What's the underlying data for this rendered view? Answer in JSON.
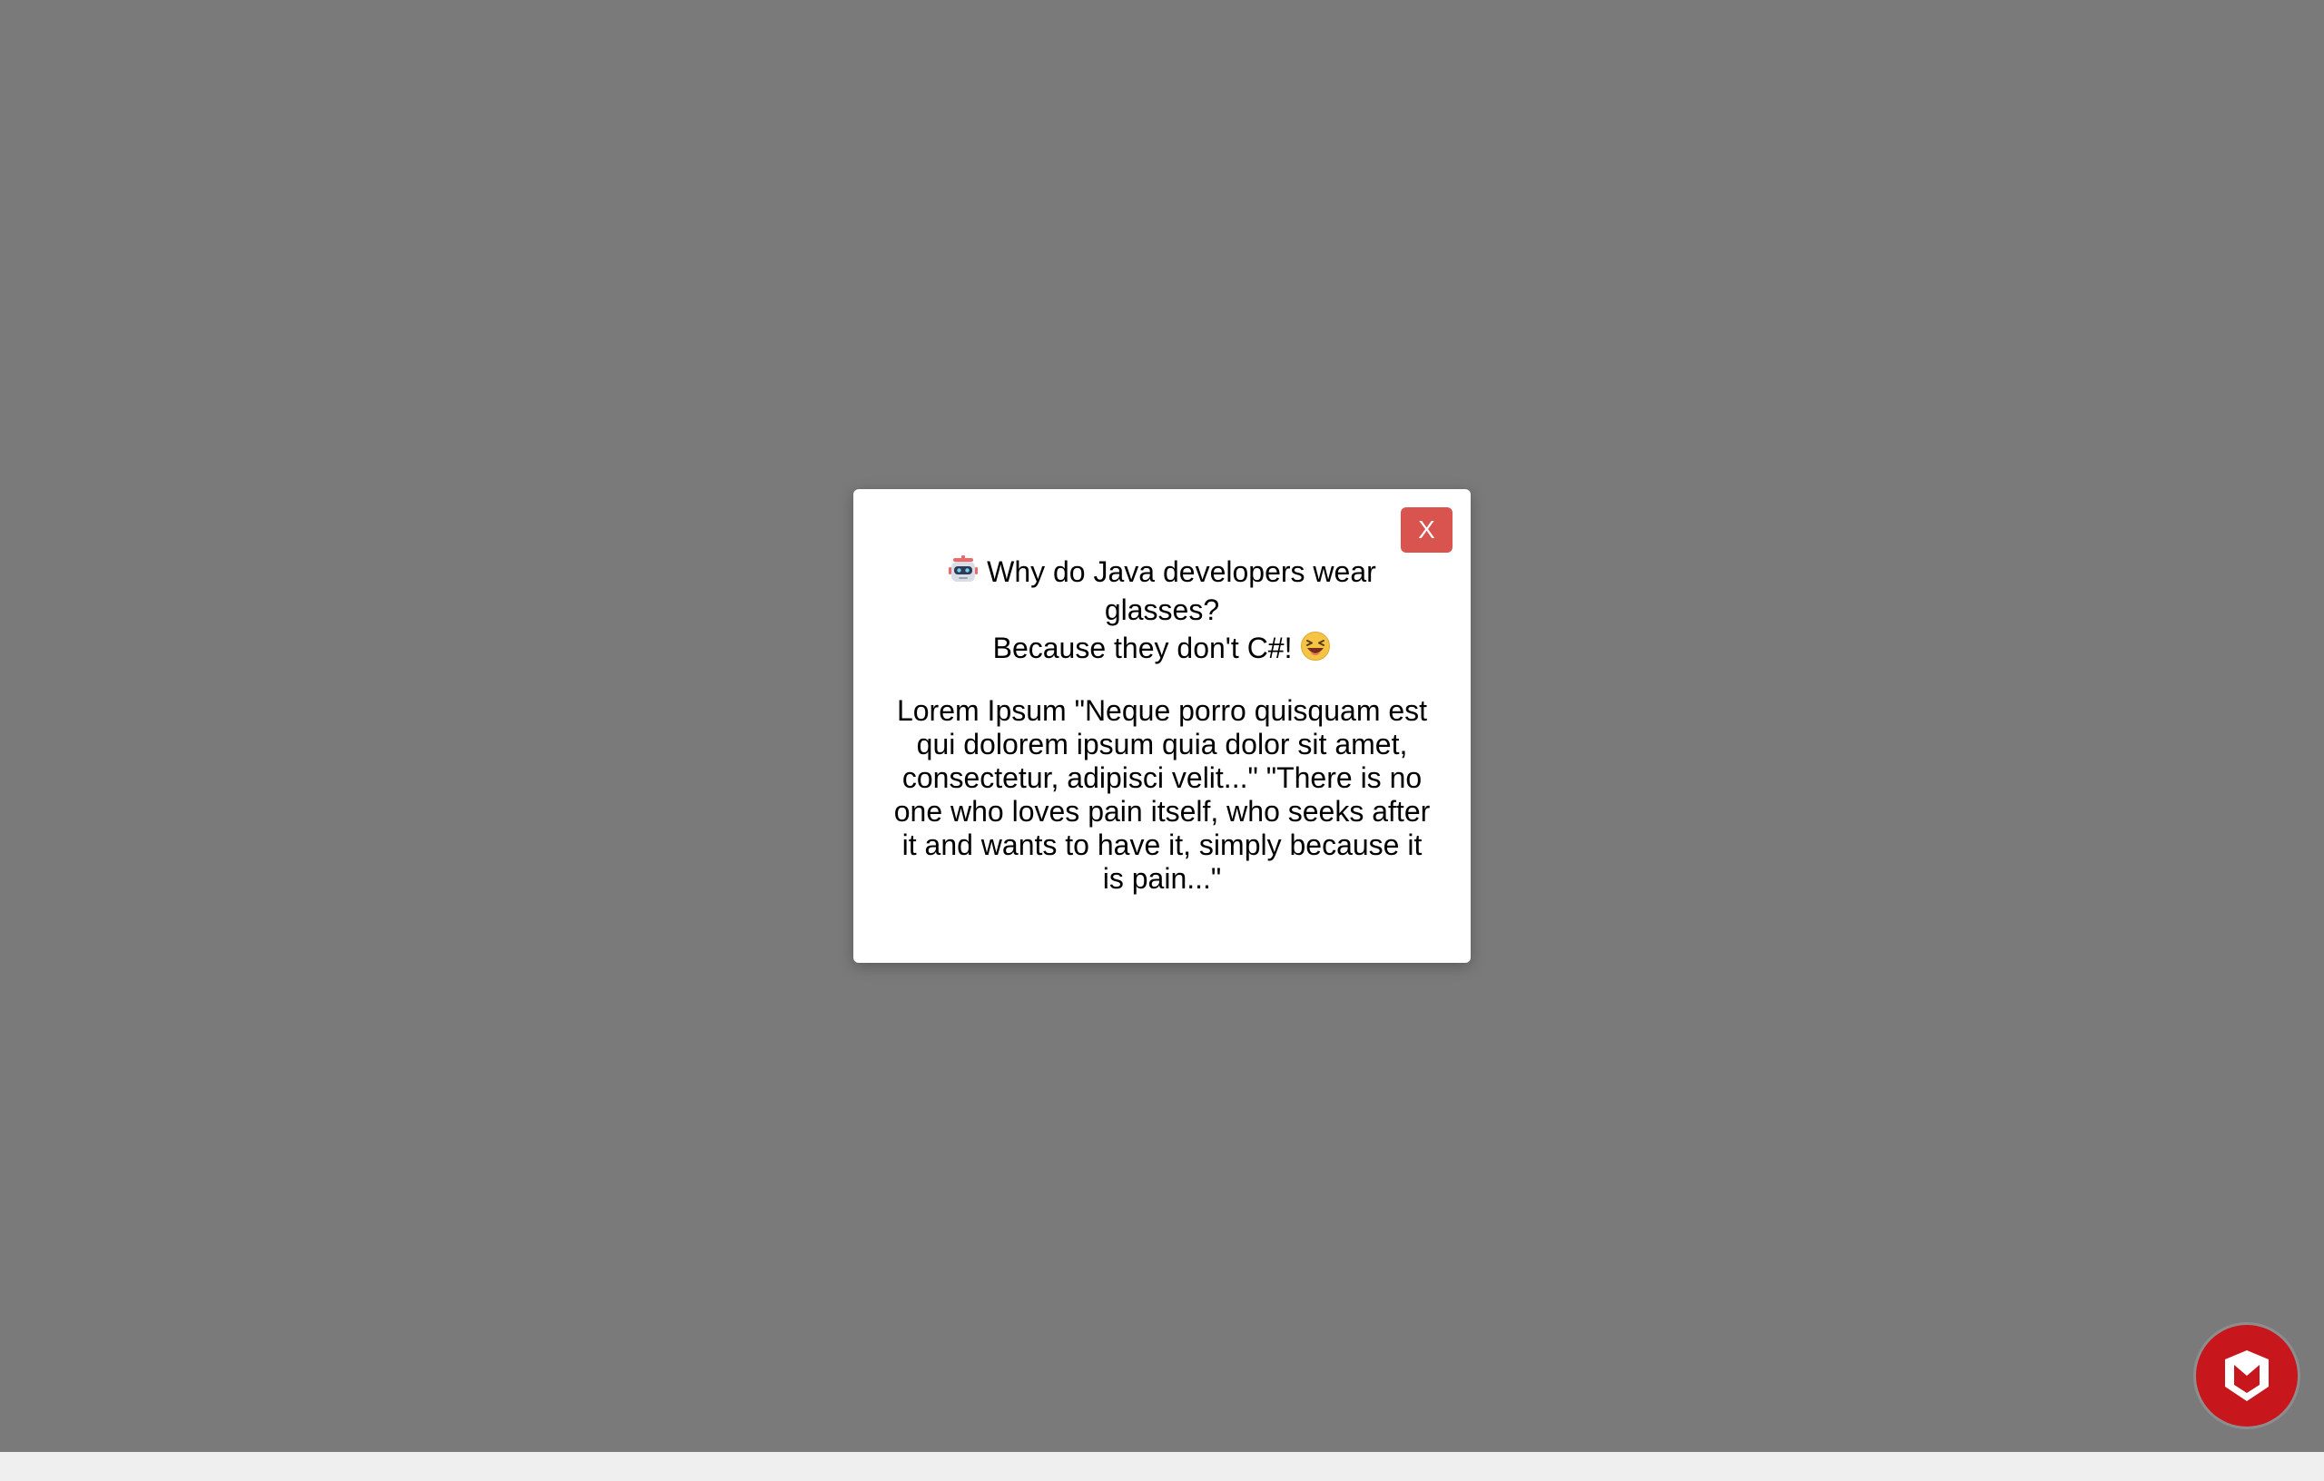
{
  "modal": {
    "close_label": "X",
    "question": "Why do Java developers wear glasses?",
    "answer": "Because they don't C#!",
    "question_icon": "robot-emoji",
    "answer_icon": "laughing-emoji",
    "body": "Lorem Ipsum \"Neque porro quisquam est qui dolorem ipsum quia dolor sit amet, consectetur, adipisci velit...\" \"There is no one who loves pain itself, who seeks after it and wants to have it, simply because it is pain...\""
  },
  "colors": {
    "overlay": "#7a7a7a",
    "close_button": "#d9534f",
    "security_badge": "#c8161d"
  },
  "floating_button": {
    "icon": "mcafee-shield-icon"
  }
}
